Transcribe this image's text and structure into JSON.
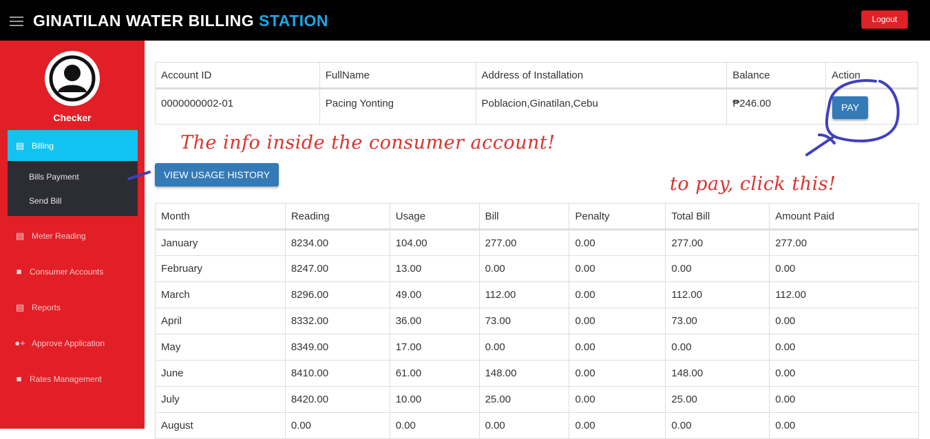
{
  "header": {
    "title_main": "GINATILAN WATER BILLING",
    "title_accent": "STATION",
    "logout_label": "Logout",
    "menu_icon": "hamburger-icon"
  },
  "sidebar": {
    "user_role": "Checker",
    "avatar_icon": "user-avatar-icon",
    "active_item": {
      "label": "Billing",
      "icon": "billing-icon"
    },
    "sub_items": [
      {
        "label": "Bills Payment"
      },
      {
        "label": "Send Bill"
      }
    ],
    "items": [
      {
        "label": "Meter Reading",
        "icon": "meter-icon"
      },
      {
        "label": "Consumer Accounts",
        "icon": "contacts-icon"
      },
      {
        "label": "Reports",
        "icon": "reports-icon"
      },
      {
        "label": "Approve Application",
        "icon": "user-plus-icon"
      },
      {
        "label": "Rates Management",
        "icon": "rates-icon"
      }
    ]
  },
  "account": {
    "headers": [
      "Account ID",
      "FullName",
      "Address of Installation",
      "Balance",
      "Action"
    ],
    "row": {
      "account_id": "0000000002-01",
      "full_name": "Pacing Yonting",
      "address": "Poblacion,Ginatilan,Cebu",
      "balance": "₱246.00",
      "action_label": "PAY"
    }
  },
  "usage_history_button": "VIEW USAGE HISTORY",
  "history": {
    "headers": [
      "Month",
      "Reading",
      "Usage",
      "Bill",
      "Penalty",
      "Total Bill",
      "Amount Paid"
    ],
    "rows": [
      [
        "January",
        "8234.00",
        "104.00",
        "277.00",
        "0.00",
        "277.00",
        "277.00"
      ],
      [
        "February",
        "8247.00",
        "13.00",
        "0.00",
        "0.00",
        "0.00",
        "0.00"
      ],
      [
        "March",
        "8296.00",
        "49.00",
        "112.00",
        "0.00",
        "112.00",
        "112.00"
      ],
      [
        "April",
        "8332.00",
        "36.00",
        "73.00",
        "0.00",
        "73.00",
        "0.00"
      ],
      [
        "May",
        "8349.00",
        "17.00",
        "0.00",
        "0.00",
        "0.00",
        "0.00"
      ],
      [
        "June",
        "8410.00",
        "61.00",
        "148.00",
        "0.00",
        "148.00",
        "0.00"
      ],
      [
        "July",
        "8420.00",
        "10.00",
        "25.00",
        "0.00",
        "25.00",
        "0.00"
      ],
      [
        "August",
        "0.00",
        "0.00",
        "0.00",
        "0.00",
        "0.00",
        "0.00"
      ]
    ]
  },
  "annotations": {
    "info_note": "The info inside the  consumer account!",
    "pay_note": "to pay, click this!"
  },
  "colors": {
    "topbar": "#000000",
    "accent": "#1ea7e4",
    "sidebar": "#e21f26",
    "active_nav": "#12c3f2",
    "button": "#337ab7",
    "logout": "#e02127",
    "note_red": "#d9332f",
    "note_blue": "#3f3fbf"
  }
}
